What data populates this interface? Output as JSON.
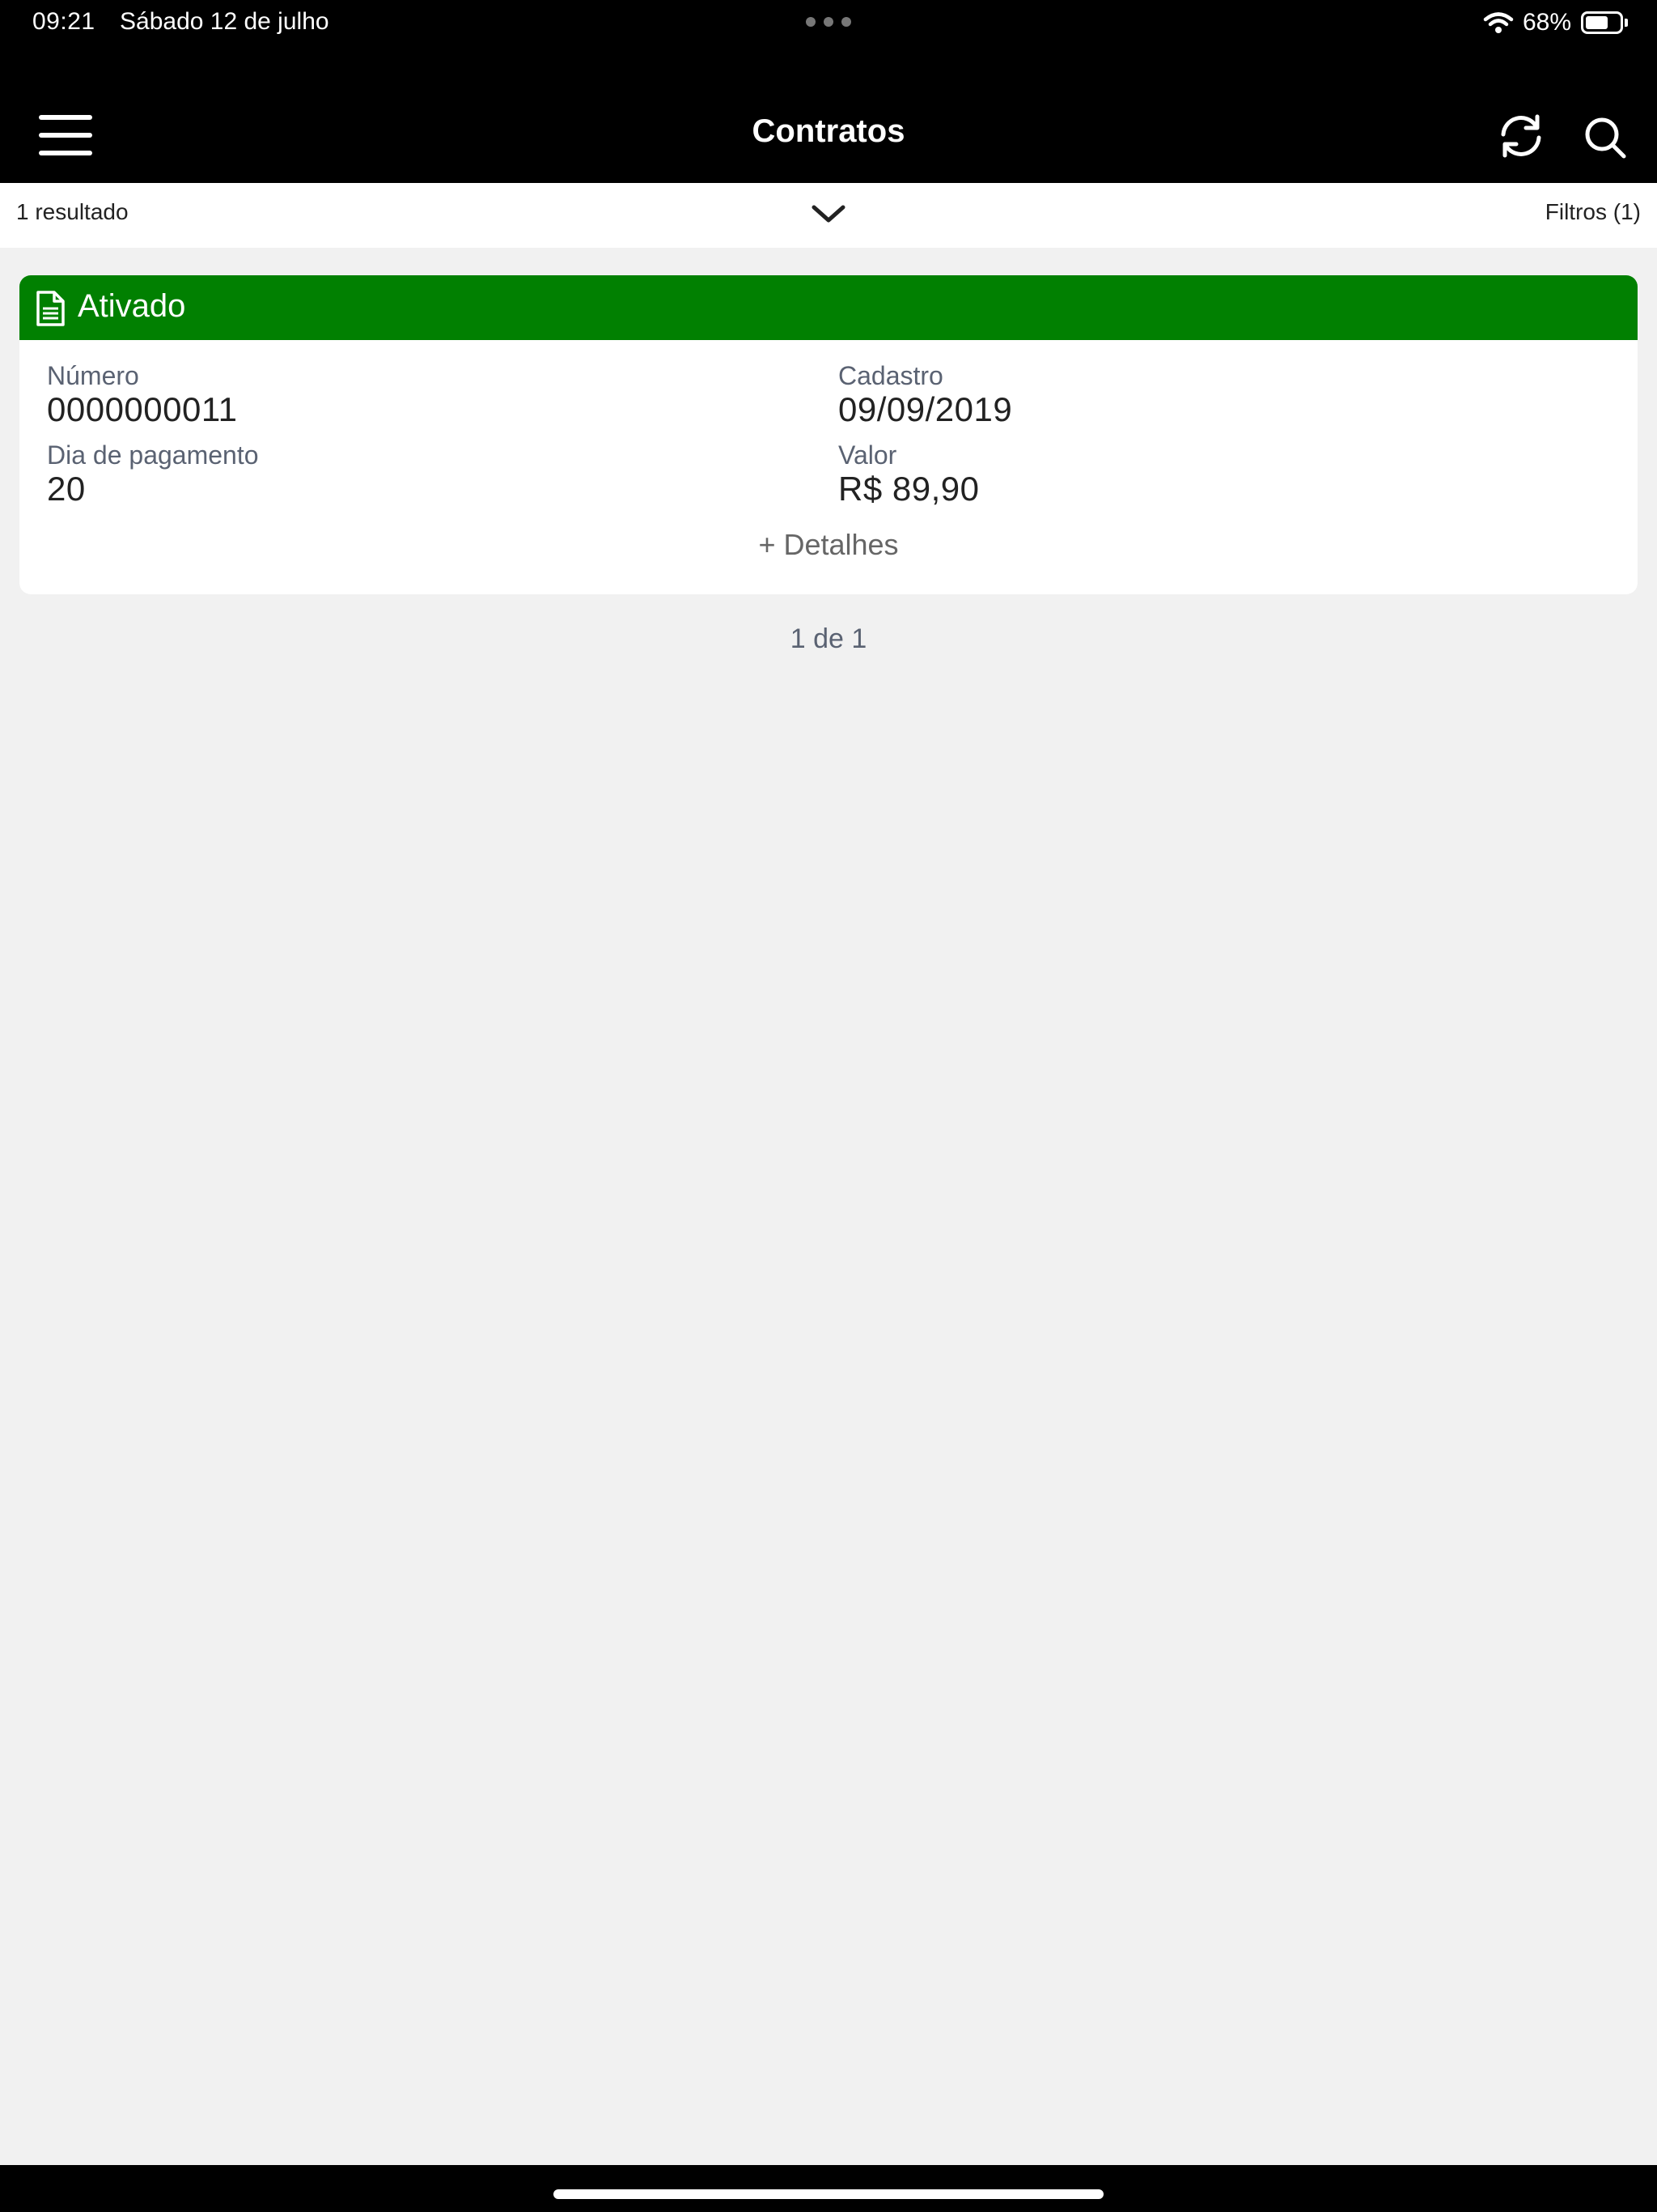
{
  "status_bar": {
    "time": "09:21",
    "date": "Sábado 12 de julho",
    "battery_percent": "68%",
    "battery_level": 0.68,
    "icons": [
      "wifi-icon",
      "battery-icon"
    ]
  },
  "nav": {
    "title": "Contratos",
    "icons": [
      "menu-icon",
      "refresh-icon",
      "search-icon"
    ]
  },
  "results": {
    "count_label": "1 resultado",
    "filters_label": "Filtros (1)"
  },
  "contract": {
    "status": "Ativado",
    "status_color": "#018001",
    "numero_label": "Número",
    "numero_value": "0000000011",
    "cadastro_label": "Cadastro",
    "cadastro_value": "09/09/2019",
    "dia_pagamento_label": "Dia de pagamento",
    "dia_pagamento_value": "20",
    "valor_label": "Valor",
    "valor_value": "R$ 89,90",
    "details_label": "+ Detalhes"
  },
  "pagination": {
    "label": "1 de 1"
  },
  "colors": {
    "bar_background": "#000000",
    "page_background": "#f1f1f1",
    "accent_green": "#018001"
  }
}
